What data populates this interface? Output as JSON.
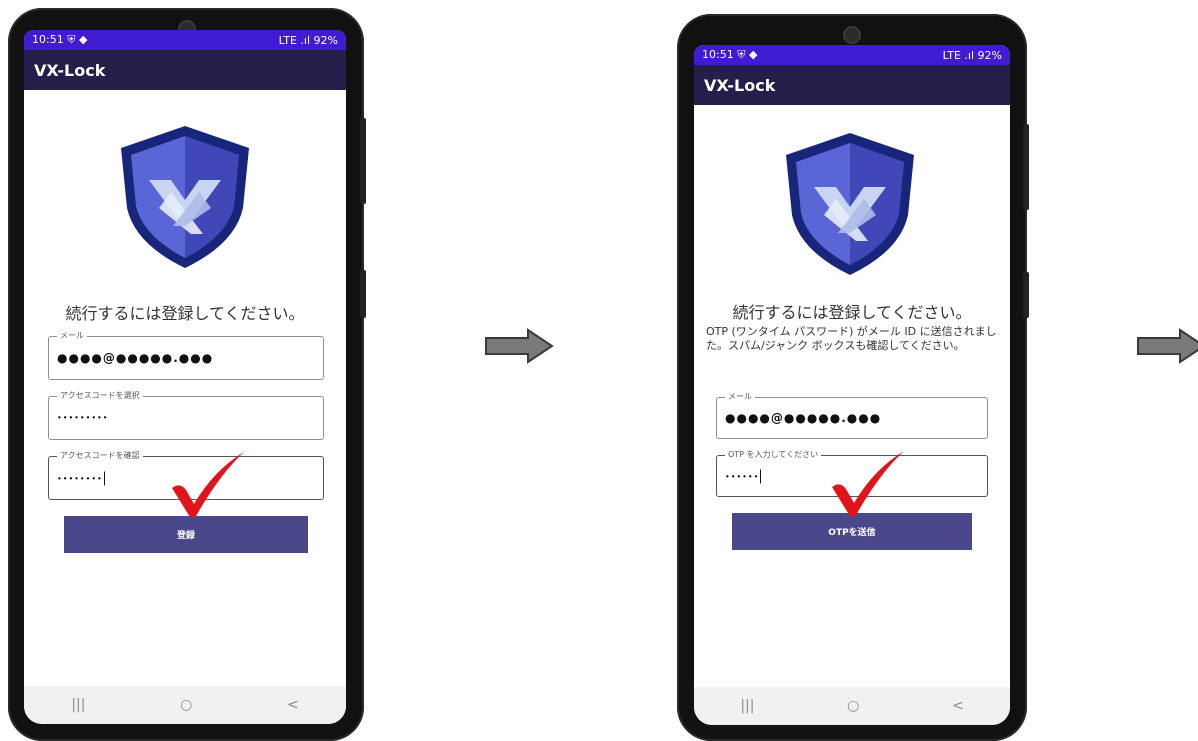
{
  "app_title": "VX-Lock",
  "status": {
    "time": "10:51",
    "icons": "⛨ ◆",
    "right": "LTE .ıl 92%"
  },
  "screen1": {
    "prompt": "続行するには登録してください。",
    "email": {
      "label": "メール",
      "value": "●●●●@●●●●●.●●●"
    },
    "access_code": {
      "label": "アクセスコードを選択",
      "value": "•••••••••"
    },
    "confirm_code": {
      "label": "アクセスコードを確認",
      "value": "••••••••"
    },
    "submit_label": "登録"
  },
  "screen2": {
    "prompt": "続行するには登録してください。",
    "info": "OTP (ワンタイム パスワード) がメール ID に送信されました。スパム/ジャンク ボックスも確認してください。",
    "email": {
      "label": "メール",
      "value": "●●●●@●●●●●.●●●"
    },
    "otp": {
      "label": "OTP を入力してください",
      "value": "••••••"
    },
    "submit_label": "OTPを送信"
  },
  "nav": {
    "recent": "|||",
    "home": "○",
    "back": "<"
  },
  "colors": {
    "status_bar": "#3f1bd1",
    "app_bar": "#231f4a",
    "button": "#4a478a",
    "check": "#e0141b",
    "shield_dark": "#1a2a86",
    "shield_light": "#5b66d6"
  },
  "icons": [
    "shield-logo-icon",
    "checkmark-icon",
    "right-arrow-icon"
  ]
}
